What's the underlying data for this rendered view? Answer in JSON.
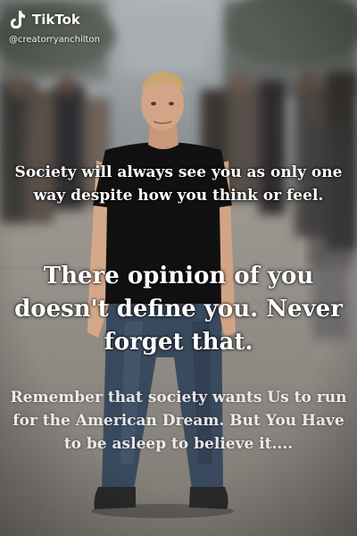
{
  "overlay": {
    "brand": "TikTok",
    "handle": "@creatorryanchilton",
    "logo_icon": "tiktok-note-icon"
  },
  "captions": {
    "block1": "Society will always see you as only one way despite how you think or feel.",
    "block2": "There opinion of you doesn't define you. Never forget that.",
    "block3": "Remember that society wants Us to run for the American Dream. But You Have to be asleep to believe it...."
  },
  "colors": {
    "text": "#ffffff",
    "shirt": "#111111",
    "jeans": "#3a4a5e",
    "pavement": "#9a958d"
  }
}
